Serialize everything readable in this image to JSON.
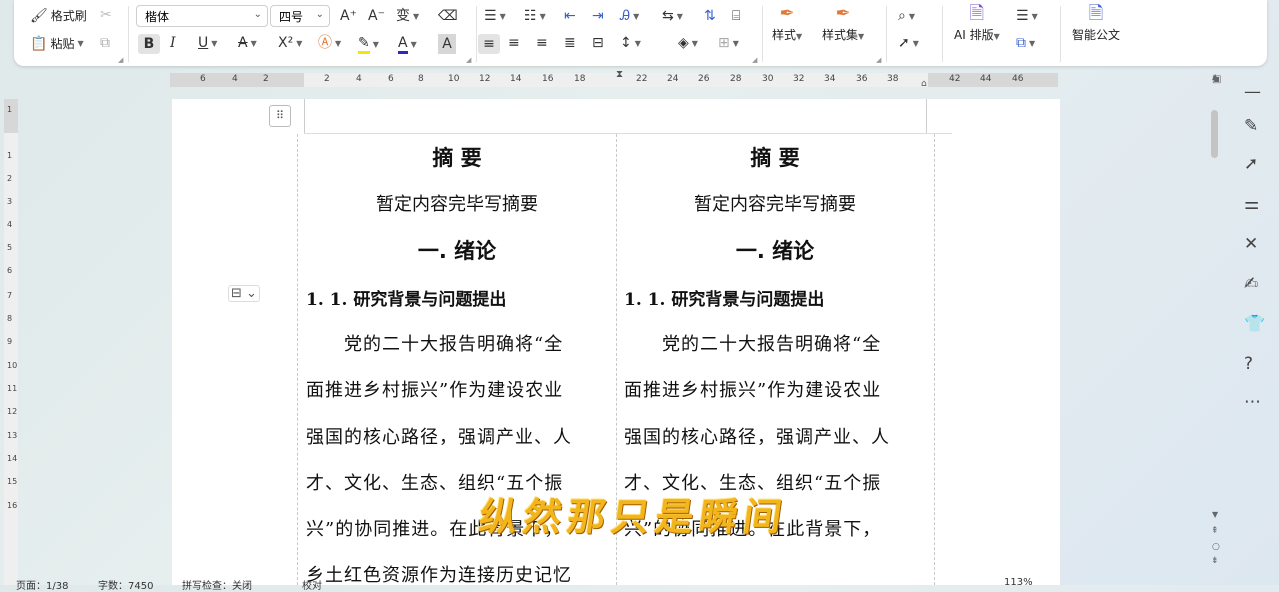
{
  "toolbar": {
    "format_painter": "格式刷",
    "paste": "粘贴",
    "font_name": "楷体",
    "font_size": "四号",
    "styles": "样式",
    "style_set": "样式集",
    "ai_layout": "AI 排版",
    "smart_doc": "智能公文"
  },
  "ruler": {
    "h_ticks": [
      "6",
      "4",
      "2",
      "2",
      "4",
      "6",
      "8",
      "10",
      "12",
      "14",
      "16",
      "18",
      "22",
      "24",
      "26",
      "28",
      "30",
      "32",
      "34",
      "36",
      "38",
      "42",
      "44",
      "46"
    ],
    "v_ticks": [
      "1",
      "1",
      "2",
      "3",
      "4",
      "5",
      "6",
      "7",
      "8",
      "9",
      "10",
      "11",
      "12",
      "13",
      "14",
      "15",
      "16"
    ]
  },
  "document": {
    "columns": [
      {
        "title": "摘 要",
        "subtitle": "暂定内容完毕写摘要",
        "chapter": "一. 绪论",
        "section": "1. 1. 研究背景与问题提出",
        "lines": [
          "　　党的二十大报告明确将“全",
          "面推进乡村振兴”作为建设农业",
          "强国的核心路径，强调产业、人",
          "才、文化、生态、组织“五个振",
          "兴”的协同推进。在此背景下，",
          "乡土红色资源作为连接历史记忆"
        ]
      },
      {
        "title": "摘 要",
        "subtitle": "暂定内容完毕写摘要",
        "chapter": "一. 绪论",
        "section": "1. 1. 研究背景与问题提出",
        "lines": [
          "　　党的二十大报告明确将“全",
          "面推进乡村振兴”作为建设农业",
          "强国的核心路径，强调产业、人",
          "才、文化、生态、组织“五个振",
          "兴”的协同推进。在此背景下，"
        ]
      }
    ],
    "watermark": "纵然那只是瞬间"
  },
  "status": {
    "page": "页面：1/38",
    "words": "字数：7450",
    "spell": "拼写检查：关闭",
    "proofread": "校对",
    "zoom": "113%"
  }
}
